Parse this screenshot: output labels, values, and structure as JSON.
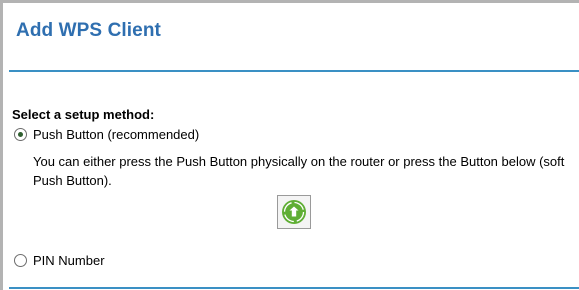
{
  "page": {
    "title": "Add WPS Client",
    "section_label": "Select a setup method:"
  },
  "options": {
    "push_button": {
      "label": "Push Button (recommended)",
      "selected": true,
      "description": "You can either press the Push Button physically on the router or press the Button below (soft Push Button)."
    },
    "pin_number": {
      "label": "PIN Number",
      "selected": false
    }
  },
  "wps_button": {
    "icon": "wps-push-icon"
  },
  "colors": {
    "title": "#2f6fb0",
    "rule": "#3a90c4",
    "wps_icon": "#5fae34"
  }
}
